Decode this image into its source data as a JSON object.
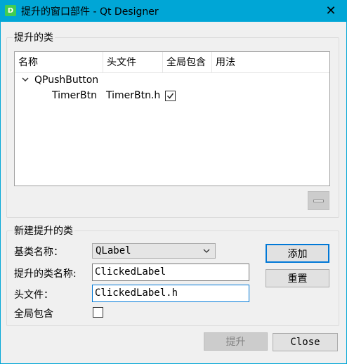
{
  "window": {
    "title": "提升的窗口部件 - Qt Designer",
    "app_icon_letter": "D",
    "close_glyph": "✕"
  },
  "promoted": {
    "group_title": "提升的类",
    "columns": [
      "名称",
      "头文件",
      "全局包含",
      "用法"
    ],
    "rows": [
      {
        "kind": "parent",
        "name": "QPushButton",
        "expanded": true,
        "expander_icon": "chevron-down-icon"
      },
      {
        "kind": "child",
        "name": "TimerBtn",
        "header": "TimerBtn.h",
        "global_include": true
      }
    ],
    "remove_button_icon": "minus-icon"
  },
  "new_promoted": {
    "group_title": "新建提升的类",
    "base_class_label": "基类名称：",
    "base_class_value": "QLabel",
    "class_name_label": "提升的类名称:",
    "class_name_value": "ClickedLabel",
    "header_label": "头文件：",
    "header_value": "ClickedLabel.h",
    "global_include_label": "全局包含",
    "global_include_checked": false,
    "add_button": "添加",
    "reset_button": "重置"
  },
  "footer": {
    "promote_button": "提升",
    "close_button": "Close"
  }
}
